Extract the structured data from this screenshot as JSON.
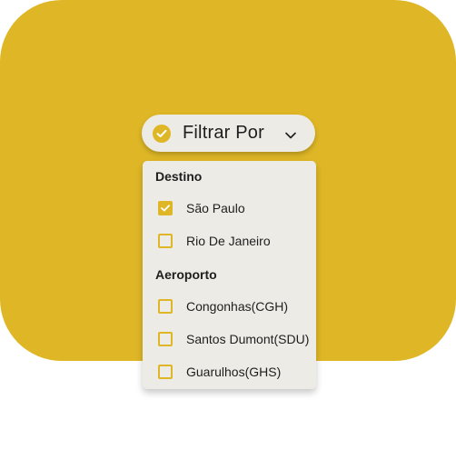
{
  "colors": {
    "accent": "#dfb726",
    "surface": "#ecebe6",
    "text": "#1e1e1e"
  },
  "filter": {
    "label": "Filtrar Por",
    "icon": "check-circle-icon",
    "toggle_icon": "chevron-down-icon"
  },
  "dropdown": {
    "groups": [
      {
        "title": "Destino",
        "options": [
          {
            "label": "São Paulo",
            "checked": true
          },
          {
            "label": "Rio De Janeiro",
            "checked": false
          }
        ]
      },
      {
        "title": "Aeroporto",
        "options": [
          {
            "label": "Congonhas(CGH)",
            "checked": false
          },
          {
            "label": "Santos Dumont(SDU)",
            "checked": false
          },
          {
            "label": "Guarulhos(GHS)",
            "checked": false
          }
        ]
      }
    ]
  }
}
